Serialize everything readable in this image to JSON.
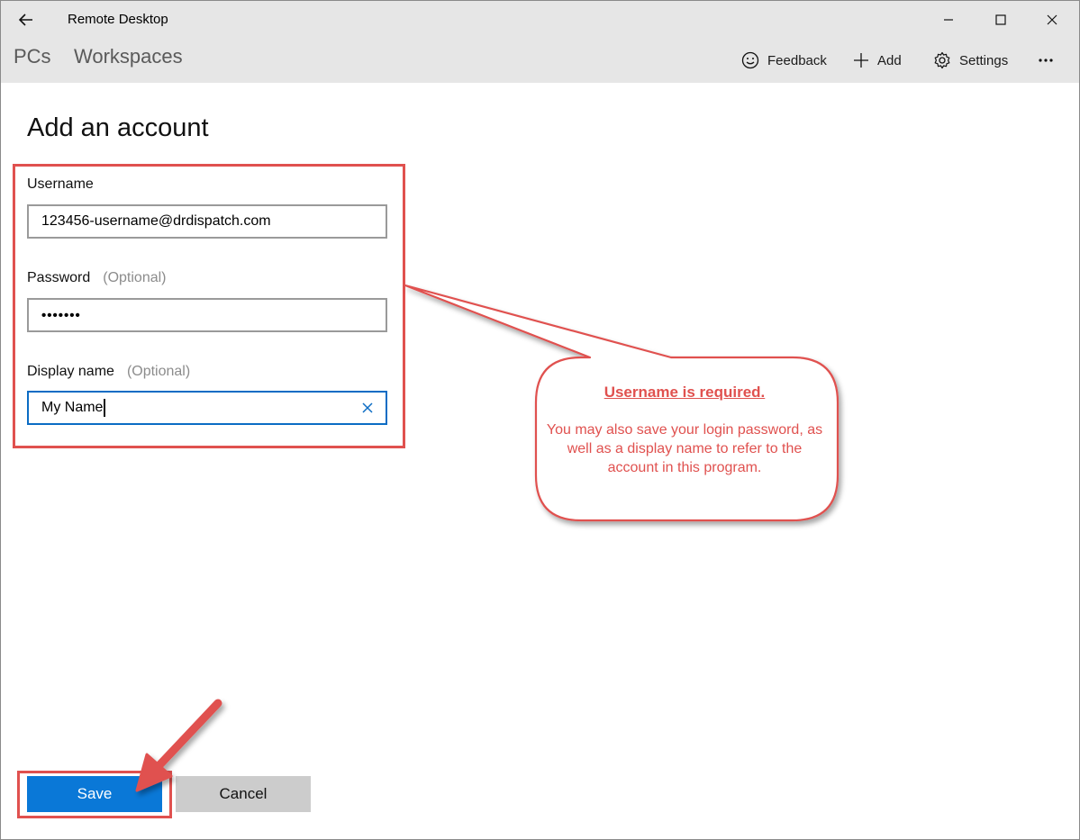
{
  "window": {
    "title": "Remote Desktop",
    "back_icon": "arrow-left-icon",
    "minimize_icon": "minimize-icon",
    "maximize_icon": "maximize-icon",
    "close_icon": "close-icon"
  },
  "nav": {
    "tabs": [
      {
        "label": "PCs"
      },
      {
        "label": "Workspaces"
      }
    ]
  },
  "commands": {
    "feedback": {
      "label": "Feedback",
      "icon": "smiley-icon"
    },
    "add": {
      "label": "Add",
      "icon": "plus-icon"
    },
    "settings": {
      "label": "Settings",
      "icon": "gear-icon"
    },
    "more_icon": "more-ellipsis-icon"
  },
  "form": {
    "title": "Add an account",
    "username": {
      "label": "Username",
      "value": "123456-username@drdispatch.com"
    },
    "password": {
      "label": "Password",
      "optional": "(Optional)",
      "value": "•••••••"
    },
    "display_name": {
      "label": "Display name",
      "optional": "(Optional)",
      "value": "My Name"
    },
    "save_label": "Save",
    "cancel_label": "Cancel"
  },
  "annotation": {
    "heading": "Username is required.",
    "body": "You may also save your login password, as well as a display name to refer to the account in this program.",
    "color": "#e0514f"
  },
  "colors": {
    "accent": "#0a78d7",
    "header_bg": "#e6e6e6",
    "annotation_red": "#e0514f"
  }
}
